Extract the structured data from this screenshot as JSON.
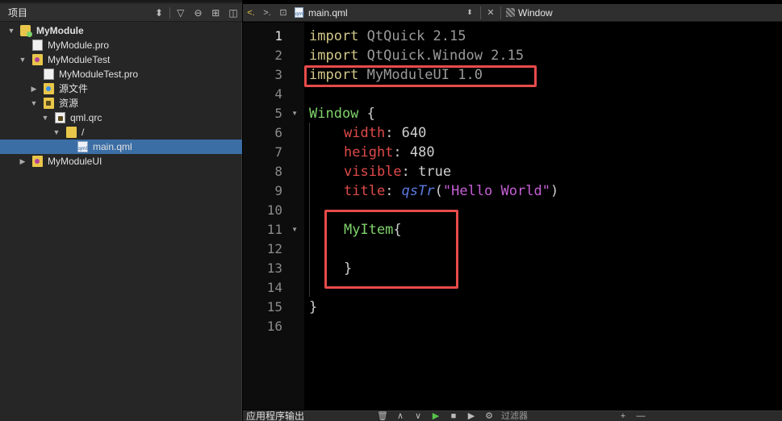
{
  "project_panel": {
    "title": "项目",
    "tree": [
      {
        "label": "MyModule",
        "bold": true
      },
      {
        "label": "MyModule.pro"
      },
      {
        "label": "MyModuleTest"
      },
      {
        "label": "MyModuleTest.pro"
      },
      {
        "label": "源文件"
      },
      {
        "label": "资源"
      },
      {
        "label": "qml.qrc"
      },
      {
        "label": "/"
      },
      {
        "label": "main.qml",
        "selected": true
      },
      {
        "label": "MyModuleUI"
      }
    ]
  },
  "editor": {
    "file_name": "main.qml",
    "symbol_label": "Window",
    "current_line": "1",
    "line_numbers": [
      "1",
      "2",
      "3",
      "4",
      "5",
      "6",
      "7",
      "8",
      "9",
      "10",
      "11",
      "12",
      "13",
      "14",
      "15",
      "16"
    ],
    "code": {
      "l1_kw": "import",
      "l1_rest": " QtQuick 2.15",
      "l2_kw": "import",
      "l2_rest": " QtQuick.Window 2.15",
      "l3_kw": "import",
      "l3_rest": " MyModuleUI 1.0",
      "l5_type": "Window",
      "l5_brace": " {",
      "l6_prop": "width",
      "l6_colon": ": ",
      "l6_val": "640",
      "l7_prop": "height",
      "l7_colon": ": ",
      "l7_val": "480",
      "l8_prop": "visible",
      "l8_colon": ": ",
      "l8_val": "true",
      "l9_prop": "title",
      "l9_colon": ": ",
      "l9_fn": "qsTr",
      "l9_open": "(",
      "l9_str": "\"Hello World\"",
      "l9_close": ")",
      "l11_type": "MyItem",
      "l11_brace": "{",
      "l13_brace": "}",
      "l15_brace": "}"
    }
  },
  "output_panel": {
    "title": "应用程序输出",
    "filter_placeholder": "过滤器"
  },
  "colors": {
    "highlight_box": "#e84b4b",
    "selection": "#3b6ea5"
  }
}
